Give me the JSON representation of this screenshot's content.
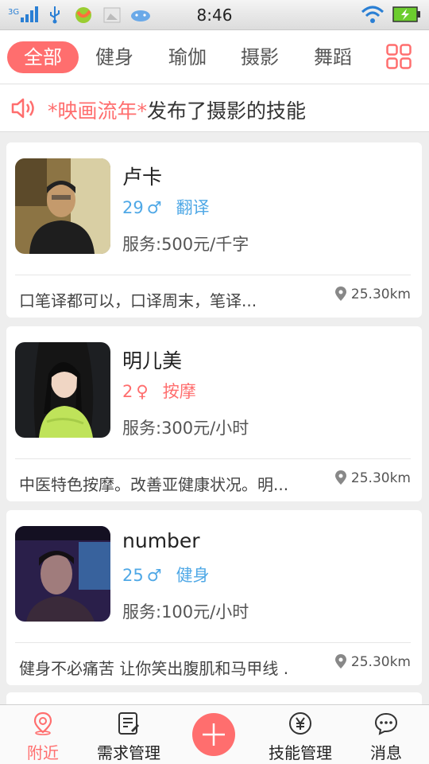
{
  "status_bar": {
    "time": "8:46",
    "network": "3G"
  },
  "categories": [
    {
      "label": "全部",
      "active": true
    },
    {
      "label": "健身",
      "active": false
    },
    {
      "label": "瑜伽",
      "active": false
    },
    {
      "label": "摄影",
      "active": false
    },
    {
      "label": "舞蹈",
      "active": false
    }
  ],
  "notice": {
    "highlight": "*映画流年*",
    "text": "发布了摄影的技能"
  },
  "cards": [
    {
      "name": "卢卡",
      "age": "29",
      "gender": "♂",
      "skill": "翻译",
      "price": "服务:500元/千字",
      "description": "口笔译都可以，口译周末，笔译...",
      "distance": "25.30km"
    },
    {
      "name": "明儿美",
      "age": "2",
      "gender": "♀",
      "skill": "按摩",
      "price": "服务:300元/小时",
      "description": "中医特色按摩。改善亚健康状况。明...",
      "distance": "25.30km"
    },
    {
      "name": "number",
      "age": "25",
      "gender": "♂",
      "skill": "健身",
      "price": "服务:100元/小时",
      "description": "健身不必痛苦  让你笑出腹肌和马甲线 ...",
      "distance": "25.30km"
    }
  ],
  "bottom_nav": {
    "nearby": "附近",
    "demand": "需求管理",
    "skills": "技能管理",
    "messages": "消息"
  },
  "colors": {
    "accent": "#ff6e6e",
    "male": "#4fa8e6"
  }
}
